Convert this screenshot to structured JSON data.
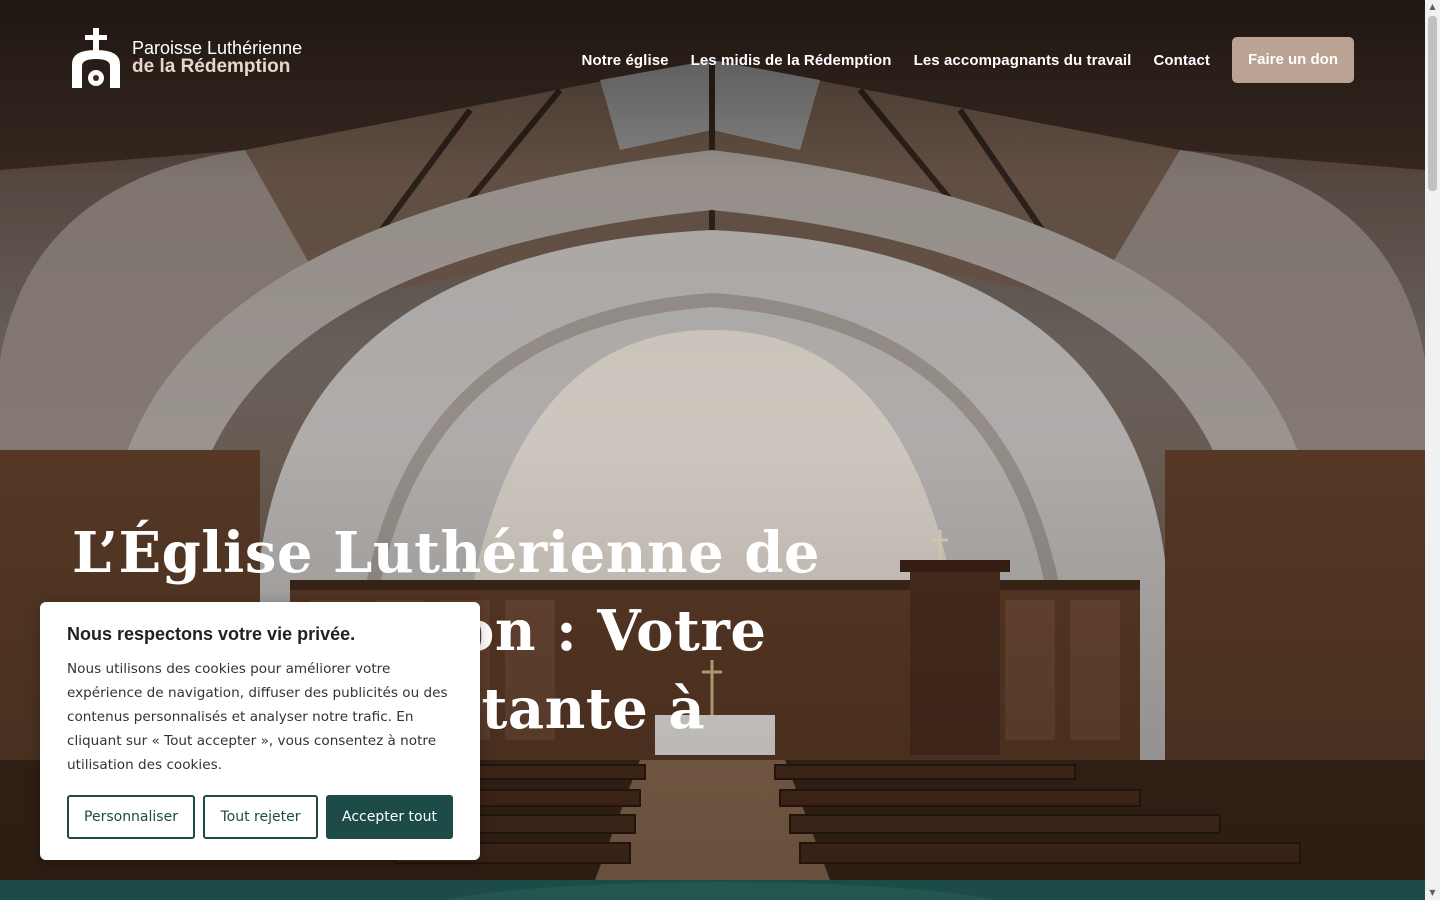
{
  "brand": {
    "line1": "Paroisse Luthérienne",
    "line2": "de la Rédemption"
  },
  "nav": {
    "items": [
      {
        "label": "Notre église"
      },
      {
        "label": "Les midis de la Rédemption"
      },
      {
        "label": "Les accompagnants du travail"
      },
      {
        "label": "Contact"
      }
    ],
    "cta_label": "Faire un don"
  },
  "hero": {
    "title": "L’Église Luthérienne de la Rédemption : Votre église protestante à Paris 9"
  },
  "cookie": {
    "title": "Nous respectons votre vie privée.",
    "text": "Nous utilisons des cookies pour améliorer votre expérience de navigation, diffuser des publicités ou des contenus personnalisés et analyser notre trafic. En cliquant sur « Tout accepter », vous consentez à notre utilisation des cookies.",
    "customize_label": "Personnaliser",
    "reject_label": "Tout rejeter",
    "accept_label": "Accepter tout"
  },
  "colors": {
    "accent_green": "#1d4b47",
    "cta_taupe": "#bba393"
  },
  "icons": {
    "logo": "church-cross-icon"
  }
}
